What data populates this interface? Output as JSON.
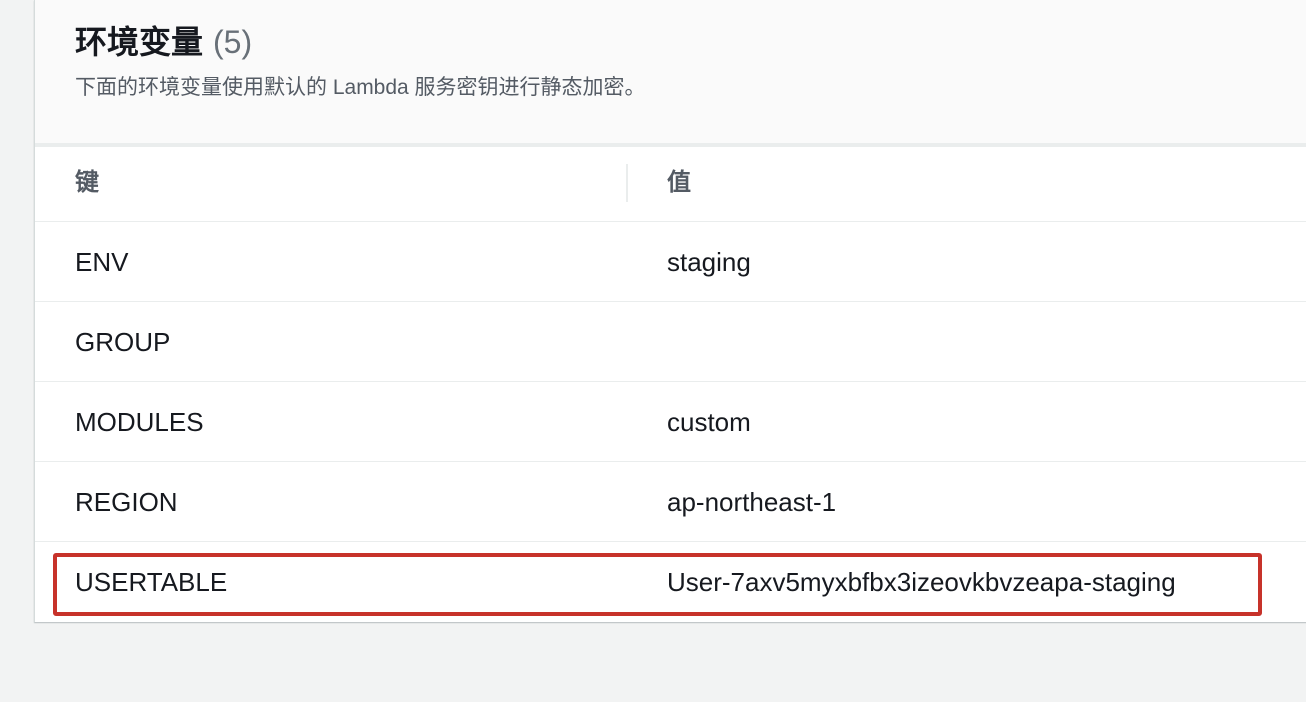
{
  "panel": {
    "title": "环境变量",
    "count": "(5)",
    "description": "下面的环境变量使用默认的 Lambda 服务密钥进行静态加密。"
  },
  "table": {
    "headers": {
      "key": "键",
      "value": "值"
    },
    "rows": [
      {
        "key": "ENV",
        "value": "staging"
      },
      {
        "key": "GROUP",
        "value": ""
      },
      {
        "key": "MODULES",
        "value": "custom"
      },
      {
        "key": "REGION",
        "value": "ap-northeast-1"
      },
      {
        "key": "USERTABLE",
        "value": "User-7axv5myxbfbx3izeovkbvzeapa-staging"
      }
    ]
  },
  "colors": {
    "highlight": "#c7322a",
    "background": "#f2f3f3",
    "panel": "#ffffff",
    "header_background": "#fafafa"
  }
}
